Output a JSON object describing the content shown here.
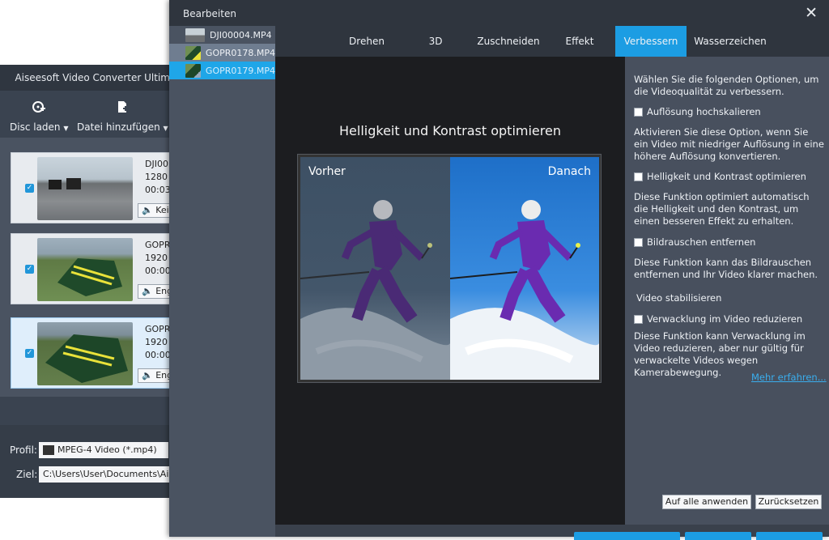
{
  "app": {
    "title": "Aiseesoft Video Converter Ultim",
    "toolbar": [
      {
        "icon": "disc-add-icon",
        "label": "Disc laden"
      },
      {
        "icon": "file-add-icon",
        "label": "Datei hinzufügen"
      }
    ],
    "videos": [
      {
        "line1": "DJI00",
        "line2": "1280",
        "line3": "00:03",
        "audio": "Kei",
        "checked": true
      },
      {
        "line1": "GOPR",
        "line2": "1920",
        "line3": "00:00",
        "audio": "Eng",
        "checked": true
      },
      {
        "line1": "GOPR",
        "line2": "1920",
        "line3": "00:00",
        "audio": "Eng",
        "checked": true
      }
    ],
    "profile_label": "Profil:",
    "profile_value": "MPEG-4 Video (*.mp4)",
    "target_label": "Ziel:",
    "target_value": "C:\\Users\\User\\Documents\\Ais"
  },
  "dialog": {
    "title": "Bearbeiten",
    "files": [
      "DJI00004.MP4",
      "GOPR0178.MP4",
      "GOPR0179.MP4"
    ],
    "tabs": [
      "Drehen",
      "3D",
      "Zuschneiden",
      "Effekt",
      "Verbessern",
      "Wasserzeichen"
    ],
    "active_tab": "Verbessern",
    "preview_title": "Helligkeit und Kontrast optimieren",
    "before_label": "Vorher",
    "after_label": "Danach",
    "panel": {
      "intro": "Wählen Sie die folgenden Optionen, um die Videoqualität zu verbessern.",
      "opt1": "Auflösung hochskalieren",
      "desc1": "Aktivieren Sie diese Option, wenn Sie ein Video mit niedriger Auflösung in eine höhere Auflösung konvertieren.",
      "opt2": "Helligkeit und Kontrast optimieren",
      "desc2": "Diese Funktion optimiert automatisch die Helligkeit und den Kontrast, um einen besseren Effekt zu erhalten.",
      "opt3": "Bildrauschen entfernen",
      "desc3": "Diese Funktion kann das Bildrauschen entfernen und Ihr Video klarer machen.",
      "section": "Video stabilisieren",
      "opt4": "Verwacklung im Video reduzieren",
      "desc4": "Diese Funktion kann Verwacklung im Video reduzieren, aber nur gültig für verwackelte Videos wegen Kamerabewegung.",
      "more": "Mehr erfahren...",
      "apply_all": "Auf alle anwenden",
      "reset": "Zurücksetzen"
    },
    "colors": {
      "accent": "#1c9de3"
    }
  }
}
